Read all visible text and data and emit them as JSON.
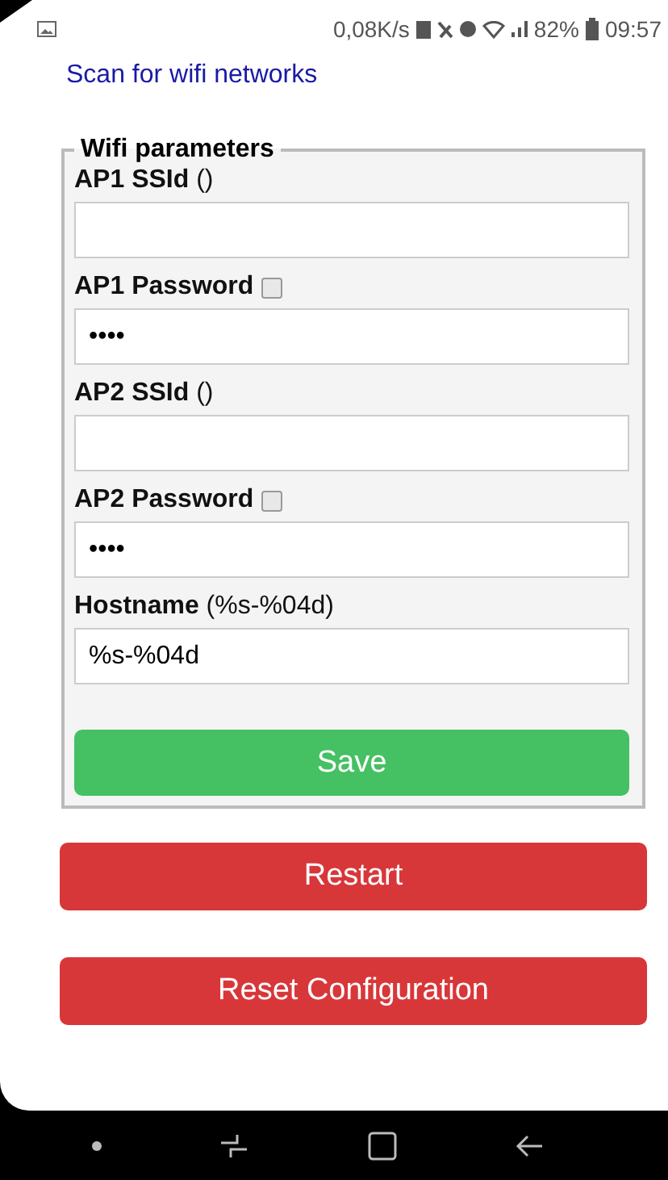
{
  "status_bar": {
    "speed": "0,08K/s",
    "battery": "82%",
    "time": "09:57"
  },
  "link": "Scan for wifi networks",
  "fieldset": {
    "legend": "Wifi parameters",
    "fields": [
      {
        "kind": "text",
        "label": "**AP1 SSId** ()"
      },
      {
        "kind": "password",
        "label": "**AP1 Password**",
        "checked": false,
        "value": "••••"
      },
      {
        "kind": "text",
        "label": "**AP2 SSId** ()"
      },
      {
        "kind": "password",
        "label": "**AP2 Password**",
        "checked": false,
        "value": "••••"
      },
      {
        "kind": "text",
        "label": "**Hostname** (%s-%04d)",
        "value": "%s-%04d"
      }
    ],
    "save": "Save"
  },
  "buttons": [
    "Restart",
    "Reset Configuration"
  ]
}
